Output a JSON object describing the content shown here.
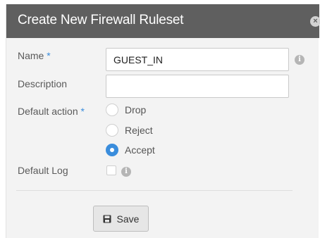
{
  "dialog": {
    "title": "Create New Firewall Ruleset",
    "close_icon": "×"
  },
  "form": {
    "name": {
      "label": "Name",
      "required_mark": "*",
      "value": "GUEST_IN"
    },
    "description": {
      "label": "Description",
      "value": ""
    },
    "default_action": {
      "label": "Default action",
      "required_mark": "*",
      "options": [
        "Drop",
        "Reject",
        "Accept"
      ],
      "selected": "Accept"
    },
    "default_log": {
      "label": "Default Log",
      "checked": false
    }
  },
  "buttons": {
    "save_label": "Save"
  },
  "icons": {
    "info": "info-icon",
    "close": "close-icon",
    "save": "floppy-disk-icon"
  },
  "colors": {
    "titlebar": "#5f5f5f",
    "accent": "#3a8ddc",
    "dialog_bg": "#f3f3f3"
  }
}
